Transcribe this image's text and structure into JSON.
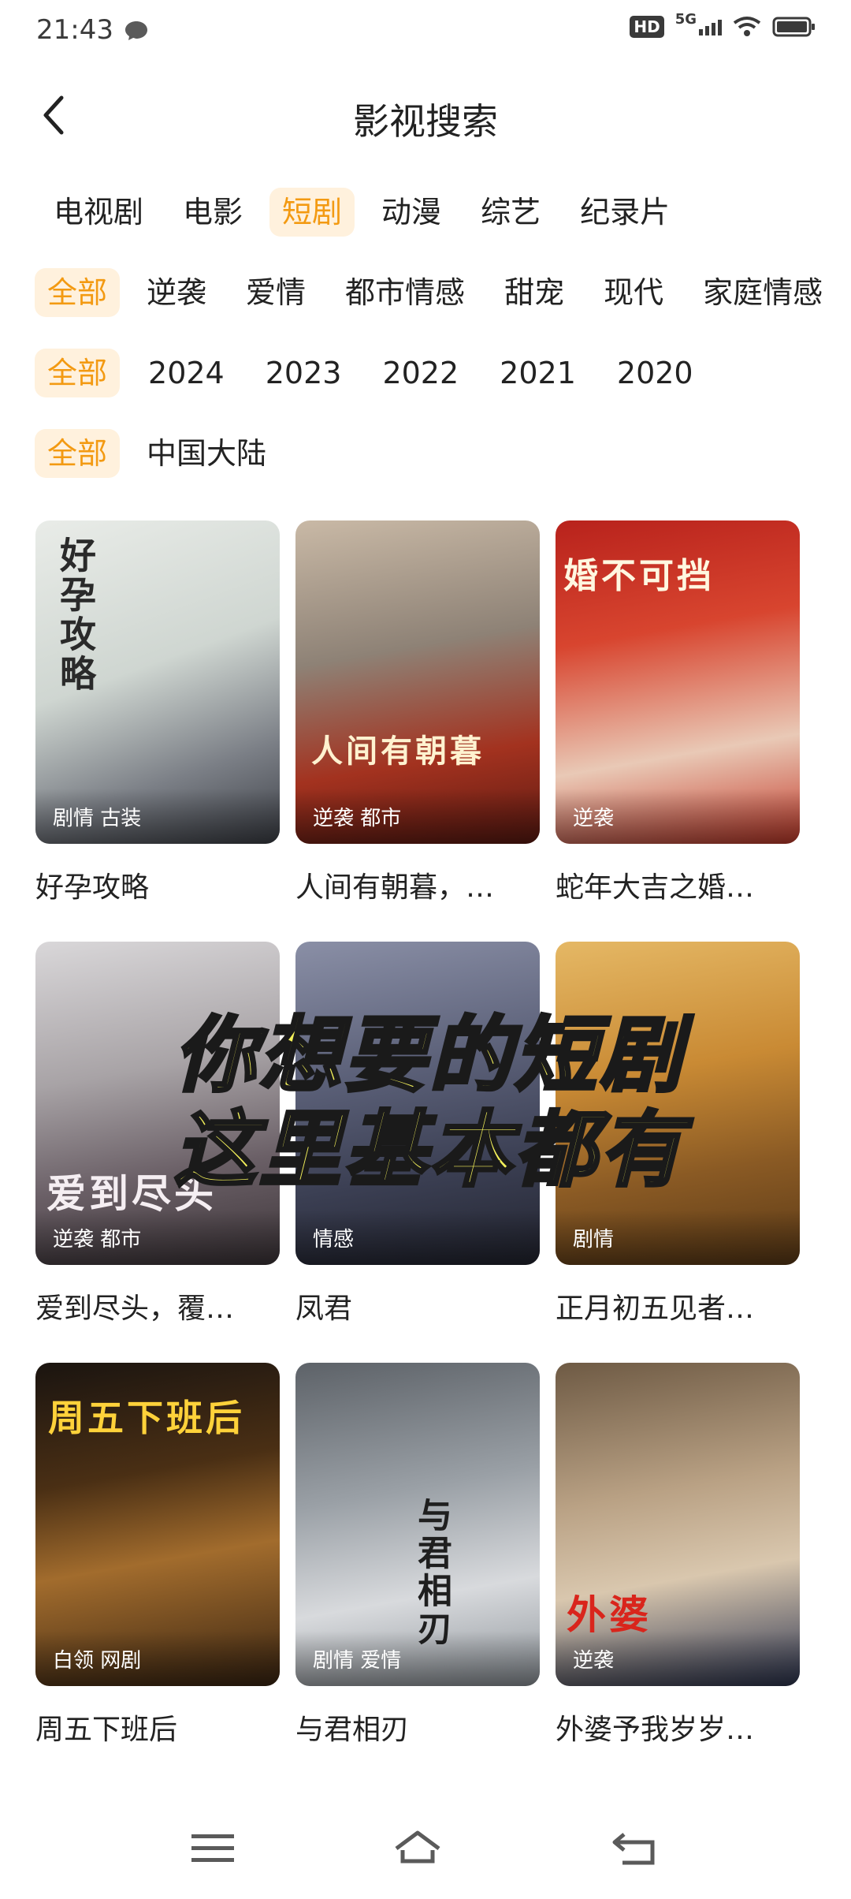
{
  "status": {
    "time": "21:43",
    "hd": "HD",
    "network": "5G"
  },
  "header": {
    "title": "影视搜索"
  },
  "filters": {
    "category": [
      "电视剧",
      "电影",
      "短剧",
      "动漫",
      "综艺",
      "纪录片"
    ],
    "genre": [
      "全部",
      "逆袭",
      "爱情",
      "都市情感",
      "甜宠",
      "现代",
      "家庭情感"
    ],
    "year": [
      "全部",
      "2024",
      "2023",
      "2022",
      "2021",
      "2020"
    ],
    "region": [
      "全部",
      "中国大陆"
    ]
  },
  "cards": [
    {
      "title": "好孕攻略",
      "tags": "剧情 古装",
      "poster_text": "好孕攻略"
    },
    {
      "title": "人间有朝暮，…",
      "tags": "逆袭 都市",
      "poster_text": "人间有朝暮"
    },
    {
      "title": "蛇年大吉之婚…",
      "tags": "逆袭",
      "poster_text": "婚不可挡"
    },
    {
      "title": "爱到尽头，覆…",
      "tags": "逆袭 都市",
      "poster_text": "爱到尽头"
    },
    {
      "title": "凤君",
      "tags": "情感",
      "poster_text": ""
    },
    {
      "title": "正月初五见者…",
      "tags": "剧情",
      "poster_text": ""
    },
    {
      "title": "周五下班后",
      "tags": "白领 网剧",
      "poster_text": "周五下班后"
    },
    {
      "title": "与君相刃",
      "tags": "剧情 爱情",
      "poster_text": "与君相刃"
    },
    {
      "title": "外婆予我岁岁…",
      "tags": "逆袭",
      "poster_text": "外婆"
    }
  ],
  "overlay": {
    "line1": "你想要的短剧",
    "line2": "这里基本都有"
  },
  "colors": {
    "accent": "#f39a12",
    "chip_active_bg": "#fff1dd"
  },
  "icons": {
    "back": "chevron-left-icon",
    "nav_menu": "menu-icon",
    "nav_home": "home-icon",
    "nav_back": "return-icon"
  }
}
